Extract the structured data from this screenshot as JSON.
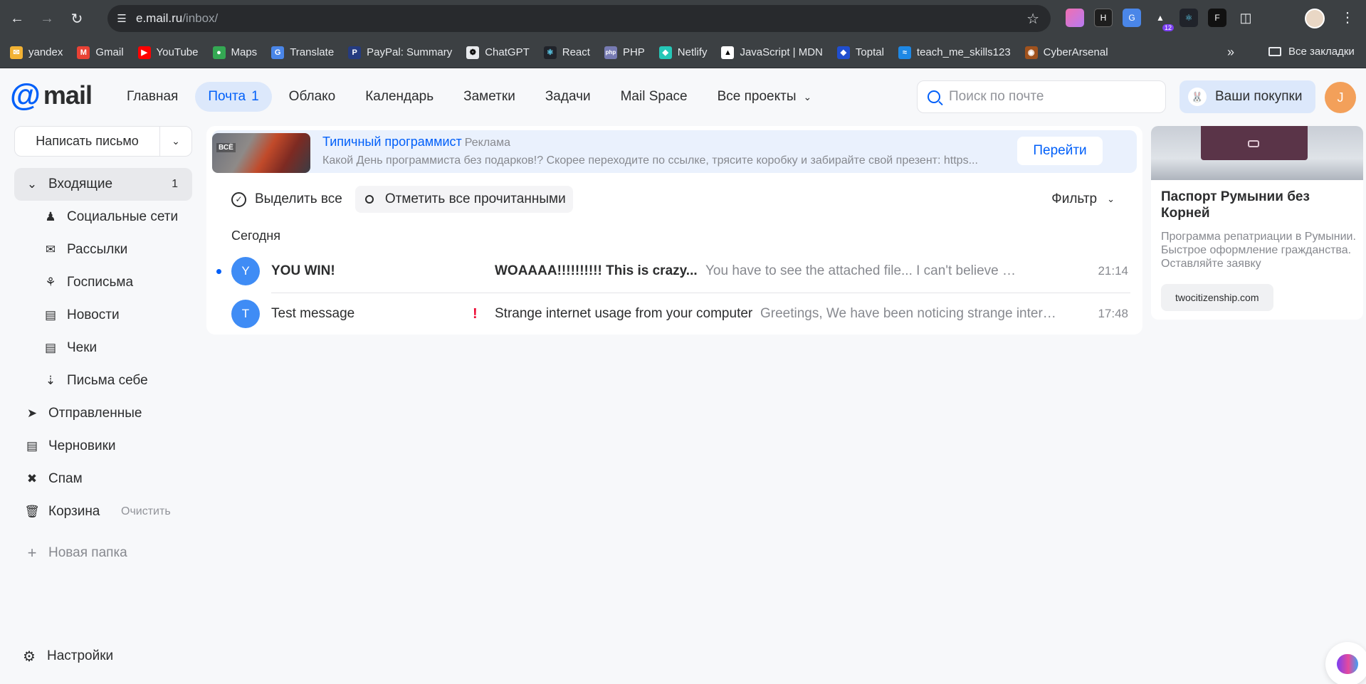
{
  "browser": {
    "url_host": "e.mail.ru",
    "url_path": "/inbox/",
    "ext_badge": "12",
    "bookmarks": [
      "yandex",
      "Gmail",
      "YouTube",
      "Maps",
      "Translate",
      "PayPal: Summary",
      "ChatGPT",
      "React",
      "PHP",
      "Netlify",
      "JavaScript | MDN",
      "Toptal",
      "teach_me_skills123",
      "CyberArsenal"
    ],
    "all_bookmarks": "Все закладки"
  },
  "header": {
    "logo_at": "@",
    "logo_word": "mail",
    "nav": {
      "home": "Главная",
      "mail": "Почта",
      "mail_count": "1",
      "cloud": "Облако",
      "calendar": "Календарь",
      "notes": "Заметки",
      "tasks": "Задачи",
      "space": "Mail Space",
      "all_projects": "Все проекты"
    },
    "search_placeholder": "Поиск по почте",
    "purchases": "Ваши покупки",
    "avatar_letter": "J"
  },
  "sidebar": {
    "compose": "Написать письмо",
    "inbox": "Входящие",
    "inbox_count": "1",
    "social": "Социальные сети",
    "newsletters": "Рассылки",
    "gov": "Госписьма",
    "news": "Новости",
    "receipts": "Чеки",
    "to_self": "Письма себе",
    "sent": "Отправленные",
    "drafts": "Черновики",
    "spam": "Спам",
    "trash": "Корзина",
    "trash_clear": "Очистить",
    "new_folder": "Новая папка",
    "settings": "Настройки"
  },
  "ad": {
    "thumb_label": "ВСЁ",
    "title": "Типичный программист",
    "tag": "Реклама",
    "description": "Какой День программиста без подарков!? Скорее переходите по ссылке, трясите коробку и забирайте свой презент: https...",
    "button": "Перейти"
  },
  "toolbar": {
    "select_all": "Выделить все",
    "mark_read": "Отметить все прочитанными",
    "filter": "Фильтр"
  },
  "section": "Сегодня",
  "messages": [
    {
      "initial": "Y",
      "from": "YOU WIN!",
      "subject": "WOAAAA!!!!!!!!!! This is crazy...",
      "snippet": "You have to see the attached file... I can't believe it...",
      "time": "21:14"
    },
    {
      "initial": "T",
      "from": "Test message",
      "important": "!",
      "subject": "Strange internet usage from your computer",
      "snippet": "Greetings, We have been noticing strange internet usage from your computer",
      "time": "17:48"
    }
  ],
  "right_ad": {
    "title": "Паспорт Румынии без Корней",
    "text": "Программа репатриации в Румынии. Быстрое оформление гражданства. Оставляйте заявку",
    "site": "twocitizenship.com"
  }
}
